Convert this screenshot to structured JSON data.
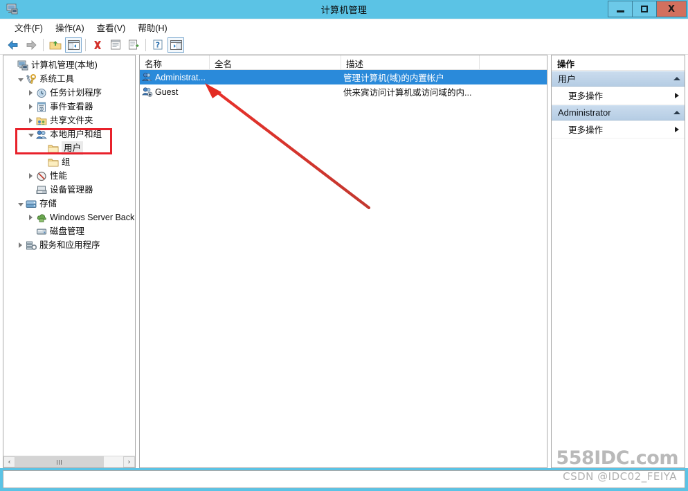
{
  "window": {
    "title": "计算机管理",
    "icon": "computer-management-icon",
    "controls": {
      "minimize": "−",
      "maximize": "□",
      "close": "X"
    }
  },
  "menubar": {
    "items": [
      {
        "label": "文件(F)",
        "name": "file"
      },
      {
        "label": "操作(A)",
        "name": "action"
      },
      {
        "label": "查看(V)",
        "name": "view"
      },
      {
        "label": "帮助(H)",
        "name": "help"
      }
    ]
  },
  "toolbar": {
    "buttons": [
      {
        "name": "back-icon",
        "framed": false
      },
      {
        "name": "forward-icon",
        "framed": false
      },
      {
        "name": "up-folder-icon",
        "framed": false
      },
      {
        "name": "show-hide-tree-icon",
        "framed": true
      },
      {
        "name": "delete-icon",
        "framed": false
      },
      {
        "name": "properties-icon",
        "framed": false
      },
      {
        "name": "export-list-icon",
        "framed": false
      },
      {
        "name": "help-icon",
        "framed": false
      },
      {
        "name": "show-action-pane-icon",
        "framed": true
      }
    ]
  },
  "tree": {
    "nodes": [
      {
        "label": "计算机管理(本地)",
        "indent": 0,
        "expander": "none",
        "icon": "computer-icon"
      },
      {
        "label": "系统工具",
        "indent": 1,
        "expander": "expanded",
        "icon": "system-tools-icon"
      },
      {
        "label": "任务计划程序",
        "indent": 2,
        "expander": "collapsed",
        "icon": "task-scheduler-icon"
      },
      {
        "label": "事件查看器",
        "indent": 2,
        "expander": "collapsed",
        "icon": "event-viewer-icon"
      },
      {
        "label": "共享文件夹",
        "indent": 2,
        "expander": "collapsed",
        "icon": "shared-folders-icon"
      },
      {
        "label": "本地用户和组",
        "indent": 2,
        "expander": "expanded",
        "icon": "local-users-groups-icon"
      },
      {
        "label": "用户",
        "indent": 3,
        "expander": "none",
        "icon": "folder-icon",
        "selected": true
      },
      {
        "label": "组",
        "indent": 3,
        "expander": "none",
        "icon": "folder-icon"
      },
      {
        "label": "性能",
        "indent": 2,
        "expander": "collapsed",
        "icon": "performance-icon"
      },
      {
        "label": "设备管理器",
        "indent": 2,
        "expander": "none",
        "icon": "device-manager-icon"
      },
      {
        "label": "存储",
        "indent": 1,
        "expander": "expanded",
        "icon": "storage-icon"
      },
      {
        "label": "Windows Server Back",
        "indent": 2,
        "expander": "collapsed",
        "icon": "windows-server-backup-icon"
      },
      {
        "label": "磁盘管理",
        "indent": 2,
        "expander": "none",
        "icon": "disk-management-icon"
      },
      {
        "label": "服务和应用程序",
        "indent": 1,
        "expander": "collapsed",
        "icon": "services-applications-icon"
      }
    ],
    "scrollbar": {
      "left_arrow": "‹",
      "right_arrow": "›"
    }
  },
  "list": {
    "columns": [
      {
        "label": "名称",
        "name": "name"
      },
      {
        "label": "全名",
        "name": "full-name"
      },
      {
        "label": "描述",
        "name": "description"
      }
    ],
    "rows": [
      {
        "name": "Administrat...",
        "full_name": "",
        "description": "管理计算机(域)的内置帐户",
        "icon": "user-icon",
        "selected": true
      },
      {
        "name": "Guest",
        "full_name": "",
        "description": "供来宾访问计算机或访问域的内...",
        "icon": "user-disabled-icon",
        "selected": false
      }
    ]
  },
  "actions": {
    "title": "操作",
    "sections": [
      {
        "heading": "用户",
        "name": "users",
        "items": [
          {
            "label": "更多操作",
            "name": "more-actions"
          }
        ]
      },
      {
        "heading": "Administrator",
        "name": "administrator",
        "items": [
          {
            "label": "更多操作",
            "name": "more-actions"
          }
        ]
      }
    ]
  },
  "annotations": {
    "highlight_box": {
      "target": "本地用户和组 / 用户",
      "color": "#e8212b"
    },
    "arrow": {
      "color": "#e02a22",
      "from": "Administrator row",
      "to": "lower right"
    }
  },
  "watermarks": {
    "site": "558IDC",
    "site_suffix": ".com",
    "credit": "CSDN @IDC02_FEIYA"
  }
}
